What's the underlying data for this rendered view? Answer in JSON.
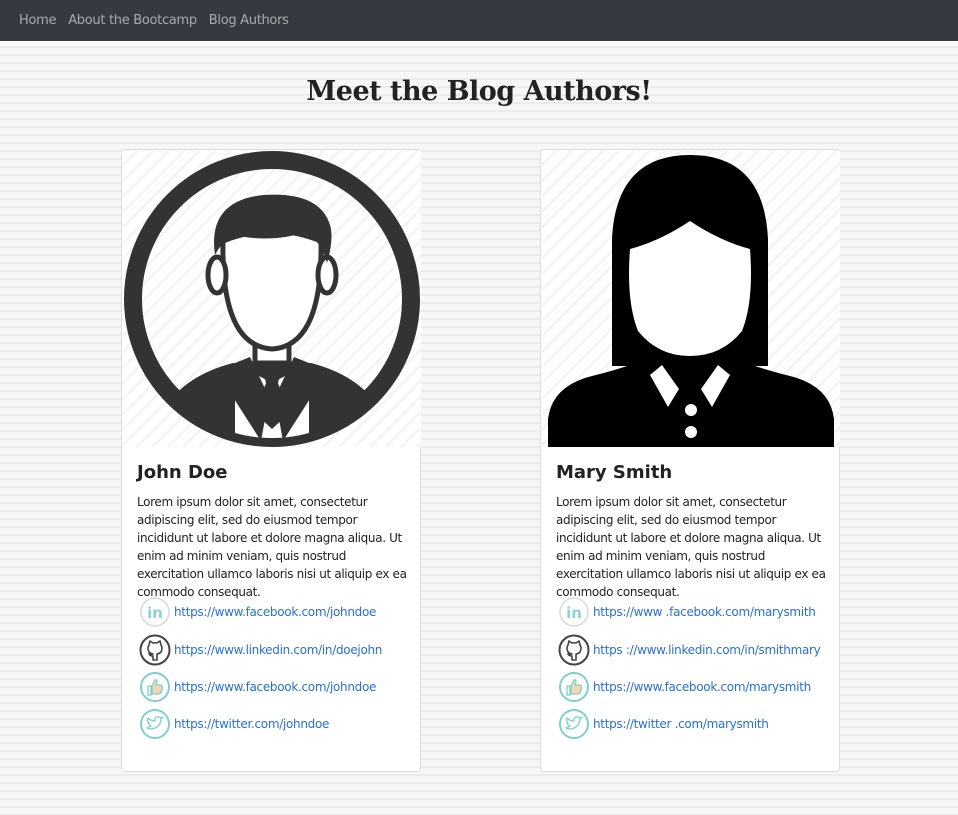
{
  "nav": {
    "items": [
      {
        "label": "Home"
      },
      {
        "label": "About the Bootcamp"
      },
      {
        "label": "Blog Authors"
      }
    ]
  },
  "page": {
    "title": "Meet the Blog Authors!"
  },
  "authors": [
    {
      "name": "John Doe",
      "avatar_icon": "male-user-icon",
      "bio": "Lorem ipsum dolor sit amet, consectetur adipiscing elit, sed do eiusmod tempor incididunt ut labore et dolore magna aliqua. Ut enim ad minim veniam, quis nostrud exercitation ullamco laboris nisi ut aliquip ex ea commodo consequat.",
      "links": [
        {
          "icon": "linkedin-icon",
          "text": "https://www.facebook.com/johndoe"
        },
        {
          "icon": "github-icon",
          "text": "https://www.linkedin.com/in/doejohn"
        },
        {
          "icon": "facebook-like-icon",
          "text": "https://www.facebook.com/johndoe"
        },
        {
          "icon": "twitter-icon",
          "text": "https://twitter.com/johndoe"
        }
      ]
    },
    {
      "name": "Mary Smith",
      "avatar_icon": "female-user-icon",
      "bio": "Lorem ipsum dolor sit amet, consectetur adipiscing elit, sed do eiusmod tempor incididunt ut labore et dolore magna aliqua. Ut enim ad minim veniam, quis nostrud exercitation ullamco laboris nisi ut aliquip ex ea commodo consequat.",
      "links": [
        {
          "icon": "linkedin-icon",
          "text": "https://www .facebook.com/marysmith"
        },
        {
          "icon": "github-icon",
          "text": "https ://www.linkedin.com/in/smithmary"
        },
        {
          "icon": "facebook-like-icon",
          "text": "https://www.facebook.com/marysmith"
        },
        {
          "icon": "twitter-icon",
          "text": "https://twitter .com/marysmith"
        }
      ]
    }
  ],
  "colors": {
    "navbar": "#343a40",
    "link": "#2a6fd0",
    "social_icon_teal": "#7fcfcf"
  }
}
